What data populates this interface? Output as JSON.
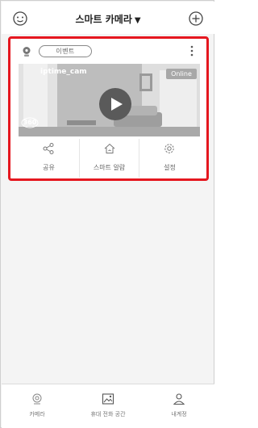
{
  "header": {
    "title": "스마트 카메라",
    "dropdown_caret": "▼",
    "left_icon": "face-icon",
    "right_icon": "add-circle-icon"
  },
  "card": {
    "event_label": "이벤트",
    "camera_name": "iptime_cam",
    "status": "Online",
    "panorama_label": "360",
    "actions": [
      {
        "label": "공유",
        "icon": "share-icon"
      },
      {
        "label": "스마트 알람",
        "icon": "home-alarm-icon"
      },
      {
        "label": "설정",
        "icon": "settings-gear-icon"
      }
    ],
    "highlight_color": "#e5171f"
  },
  "bottom_nav": {
    "items": [
      {
        "label": "카메라",
        "icon": "camera-icon"
      },
      {
        "label": "휴대 전화 공간",
        "icon": "gallery-icon"
      },
      {
        "label": "내계정",
        "icon": "account-icon"
      }
    ]
  }
}
